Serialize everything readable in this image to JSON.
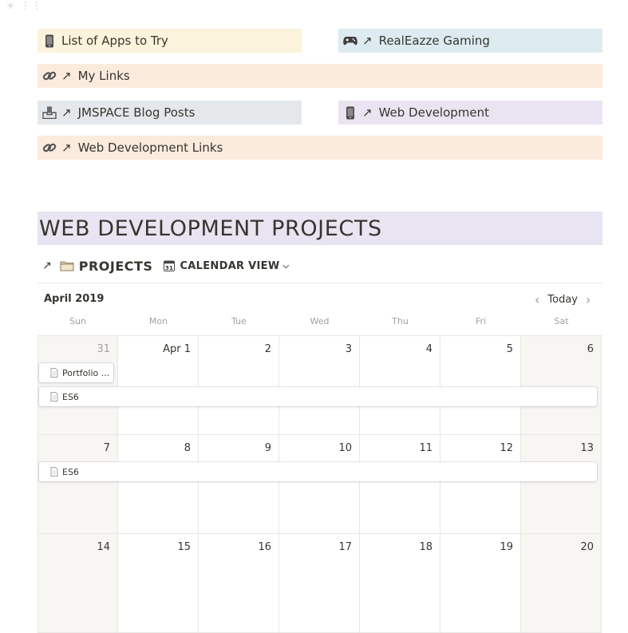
{
  "links": [
    {
      "label": "List of Apps to Try",
      "icon": "phone-icon",
      "arrow": "",
      "color": "#fbf3db"
    },
    {
      "label": "RealEazze Gaming",
      "icon": "gamepad-icon",
      "arrow": "↗",
      "color": "#ddebf1"
    },
    {
      "label": "My Links",
      "icon": "chain-link-icon",
      "arrow": "↗",
      "color": "#faebdd"
    },
    {
      "label": "JMSPACE Blog Posts",
      "icon": "inbox-tray-icon",
      "arrow": "↗",
      "color": "#e5e8eb"
    },
    {
      "label": "Web Development",
      "icon": "phone-icon",
      "arrow": "↗",
      "color": "#eae4f2"
    },
    {
      "label": "Web Development Links",
      "icon": "chain-link-icon",
      "arrow": "↗",
      "color": "#faebdd"
    }
  ],
  "heading": "WEB DEVELOPMENT PROJECTS",
  "database": {
    "arrow": "↗",
    "title": "PROJECTS",
    "view_label": "CALENDAR VIEW",
    "view_icon": "calendar-icon"
  },
  "calendar": {
    "month": "April 2019",
    "today_label": "Today",
    "weekdays": [
      "Sun",
      "Mon",
      "Tue",
      "Wed",
      "Thu",
      "Fri",
      "Sat"
    ],
    "weeks": [
      [
        "31",
        "Apr 1",
        "2",
        "3",
        "4",
        "5",
        "6"
      ],
      [
        "7",
        "8",
        "9",
        "10",
        "11",
        "12",
        "13"
      ],
      [
        "14",
        "15",
        "16",
        "17",
        "18",
        "19",
        "20"
      ]
    ],
    "events": [
      {
        "title": "Portfolio ...",
        "week": 0,
        "start_day": 0,
        "span_days": 1,
        "lane": 0
      },
      {
        "title": "ES6",
        "week": 0,
        "start_day": 0,
        "span_days": 7,
        "lane": 1
      },
      {
        "title": "ES6",
        "week": 1,
        "start_day": 0,
        "span_days": 7,
        "lane": 0
      }
    ]
  }
}
